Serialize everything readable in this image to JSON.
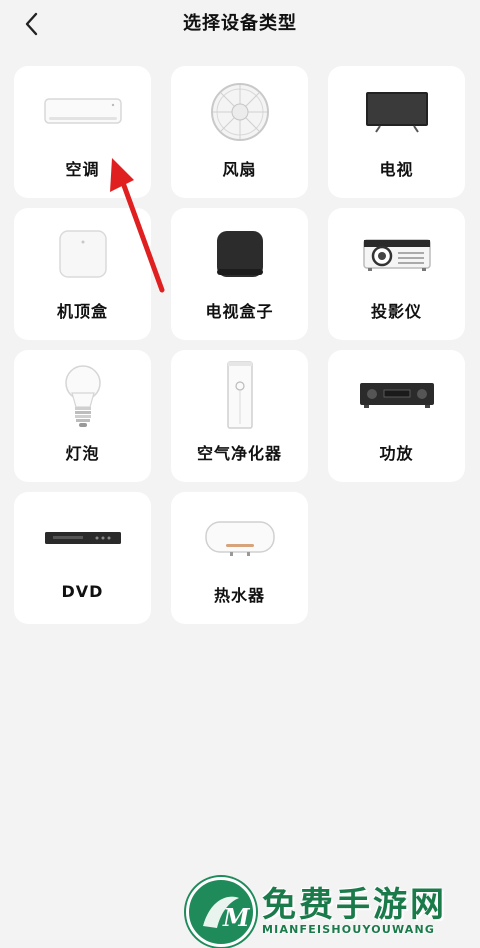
{
  "header": {
    "title": "选择设备类型",
    "back_icon": "chevron-left-icon"
  },
  "devices": [
    {
      "label": "空调",
      "icon": "air-conditioner-icon"
    },
    {
      "label": "风扇",
      "icon": "fan-icon"
    },
    {
      "label": "电视",
      "icon": "tv-icon"
    },
    {
      "label": "机顶盒",
      "icon": "set-top-box-icon"
    },
    {
      "label": "电视盒子",
      "icon": "tv-box-icon"
    },
    {
      "label": "投影仪",
      "icon": "projector-icon"
    },
    {
      "label": "灯泡",
      "icon": "light-bulb-icon"
    },
    {
      "label": "空气净化器",
      "icon": "air-purifier-icon"
    },
    {
      "label": "功放",
      "icon": "amplifier-icon"
    },
    {
      "label": "DVD",
      "icon": "dvd-player-icon"
    },
    {
      "label": "热水器",
      "icon": "water-heater-icon"
    }
  ],
  "annotation": {
    "arrow_color": "#e02020",
    "points_to": "空调"
  },
  "watermark": {
    "main": "免费手游网",
    "sub": "MIANFEISHOUYOUWANG",
    "color": "#1a7a4a"
  }
}
